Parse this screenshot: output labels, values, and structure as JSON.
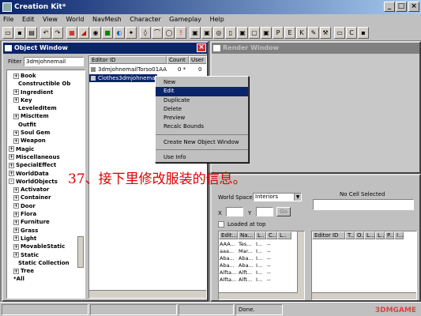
{
  "app": {
    "title": "Creation Kit*"
  },
  "menu": [
    "File",
    "Edit",
    "View",
    "World",
    "NavMesh",
    "Character",
    "Gameplay",
    "Help"
  ],
  "object_window": {
    "title": "Object Window",
    "filter_label": "Filter",
    "filter_value": "3dmjohnemail",
    "tree": [
      {
        "label": "Book",
        "exp": "+",
        "indent": 1
      },
      {
        "label": "Constructible Ob",
        "exp": "",
        "indent": 2
      },
      {
        "label": "Ingredient",
        "exp": "+",
        "indent": 1
      },
      {
        "label": "Key",
        "exp": "+",
        "indent": 1
      },
      {
        "label": "LeveledItem",
        "exp": "",
        "indent": 2
      },
      {
        "label": "MiscItem",
        "exp": "+",
        "indent": 1
      },
      {
        "label": "Outfit",
        "exp": "",
        "indent": 2
      },
      {
        "label": "Soul Gem",
        "exp": "+",
        "indent": 1
      },
      {
        "label": "Weapon",
        "exp": "+",
        "indent": 1
      },
      {
        "label": "Magic",
        "exp": "+",
        "indent": 0
      },
      {
        "label": "Miscellaneous",
        "exp": "+",
        "indent": 0
      },
      {
        "label": "SpecialEffect",
        "exp": "+",
        "indent": 0
      },
      {
        "label": "WorldData",
        "exp": "+",
        "indent": 0
      },
      {
        "label": "WorldObjects",
        "exp": "-",
        "indent": 0
      },
      {
        "label": "Activator",
        "exp": "+",
        "indent": 1
      },
      {
        "label": "Container",
        "exp": "+",
        "indent": 1
      },
      {
        "label": "Door",
        "exp": "+",
        "indent": 1
      },
      {
        "label": "Flora",
        "exp": "+",
        "indent": 1
      },
      {
        "label": "Furniture",
        "exp": "+",
        "indent": 1
      },
      {
        "label": "Grass",
        "exp": "+",
        "indent": 1
      },
      {
        "label": "Light",
        "exp": "+",
        "indent": 1
      },
      {
        "label": "MovableStatic",
        "exp": "+",
        "indent": 1
      },
      {
        "label": "Static",
        "exp": "+",
        "indent": 1
      },
      {
        "label": "Static Collection",
        "exp": "",
        "indent": 2
      },
      {
        "label": "Tree",
        "exp": "+",
        "indent": 1
      },
      {
        "label": "*All",
        "exp": "",
        "indent": 1
      }
    ],
    "columns": [
      "Editor ID",
      "Count",
      "User"
    ],
    "rows": [
      {
        "id": "3dmjohnemailTorso01AA",
        "count": "0 *",
        "user": "0"
      },
      {
        "id": "Clothes3dmjohnemail",
        "count": "",
        "user": ""
      }
    ]
  },
  "context_menu": {
    "items": [
      "New",
      "Edit",
      "Duplicate",
      "Delete",
      "Preview",
      "Recalc Bounds",
      "Create New Object Window",
      "Use Info"
    ],
    "highlighted": "Edit"
  },
  "annotation": "37、接下里修改服装的信息。",
  "render_window": {
    "title": "Render Window"
  },
  "cell_view": {
    "world_space_label": "World Space",
    "world_space_value": "Interiors",
    "x_label": "X",
    "y_label": "Y",
    "go_label": "Go",
    "loaded_at_top": "Loaded at top",
    "no_cell": "No Cell Selected",
    "left_cols": [
      "Edit...",
      "Na...",
      "L..",
      "C..",
      "L.."
    ],
    "left_rows": [
      [
        "AAA...",
        "Tes...",
        "I...",
        "--"
      ],
      [
        "aaa...",
        "Mar...",
        "I...",
        "--"
      ],
      [
        "Aba...",
        "Aba...",
        "I...",
        "--"
      ],
      [
        "Aba...",
        "Aba...",
        "I...",
        "--"
      ],
      [
        "Alfta...",
        "Alft...",
        "I...",
        "--"
      ],
      [
        "Alfta...",
        "Alft...",
        "I...",
        "--"
      ]
    ],
    "right_cols": [
      "Editor ID",
      "T...",
      "O...",
      "L...",
      "L...",
      "P...",
      "I..."
    ]
  },
  "status": {
    "text": "Done.",
    "watermark": "3DMGAME"
  }
}
